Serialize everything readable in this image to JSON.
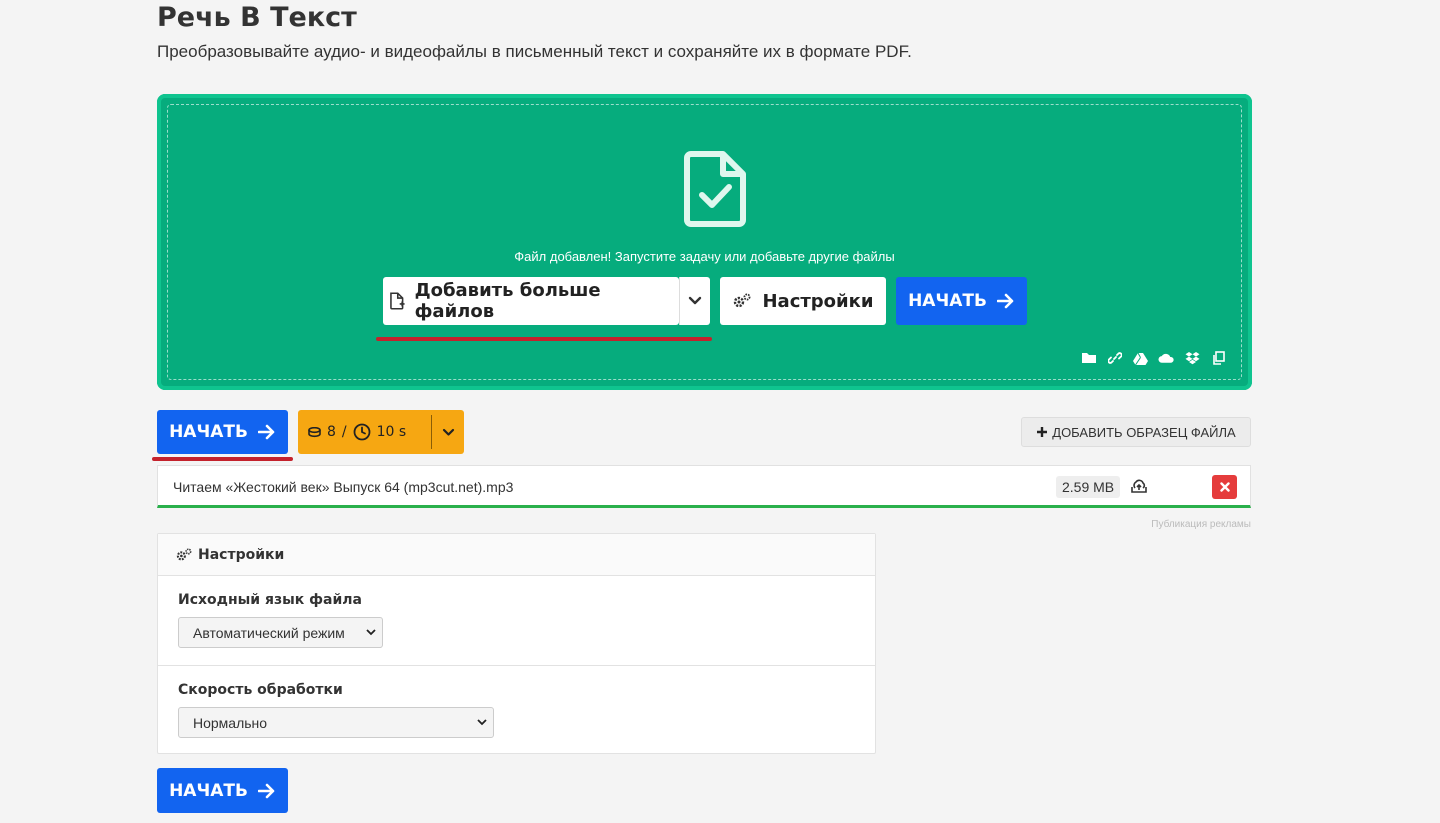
{
  "page": {
    "title": "Речь В Текст",
    "subtitle": "Преобразовывайте аудио- и видеофайлы в письменный текст и сохраняйте их в формате PDF."
  },
  "dropzone": {
    "status": "Файл добавлен! Запустите задачу или добавьте другие файлы",
    "add_more_label": "Добавить больше файлов",
    "settings_label": "Настройки",
    "start_label": "НАЧАТЬ",
    "source_icons": [
      "folder-icon",
      "link-icon",
      "google-drive-icon",
      "onedrive-icon",
      "dropbox-icon",
      "clipboard-icon"
    ]
  },
  "toolbar": {
    "start_label": "НАЧАТЬ",
    "credits": "8",
    "credits_sep": "/",
    "time": "10 s",
    "add_sample_label": "ДОБАВИТЬ ОБРАЗЕЦ ФАЙЛА"
  },
  "file": {
    "name": "Читаем «Жестокий век» Выпуск 64 (mp3cut.net).mp3",
    "size": "2.59 MB"
  },
  "ad_note": "Публикация рекламы",
  "settings": {
    "title": "Настройки",
    "language_label": "Исходный язык файла",
    "language_value": "Автоматический режим",
    "speed_label": "Скорость обработки",
    "speed_value": "Нормально"
  },
  "bottom": {
    "start_label": "НАЧАТЬ"
  },
  "colors": {
    "dropzone": "#06ac7d",
    "primary": "#1264f0",
    "credits": "#f6a712",
    "danger": "#e53c3c",
    "highlight": "#c4222c"
  }
}
